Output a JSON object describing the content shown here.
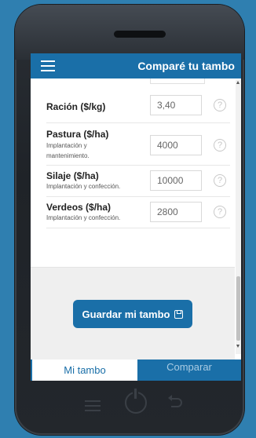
{
  "app": {
    "title": "Comparé tu tambo"
  },
  "form": {
    "rows": [
      {
        "label": "Ración ($/kg)",
        "sub": "",
        "value": "3,40"
      },
      {
        "label": "Pastura ($/ha)",
        "sub": "Implantación y mantenimiento.",
        "value": "4000"
      },
      {
        "label": "Silaje ($/ha)",
        "sub": "Implantación y confección.",
        "value": "10000"
      },
      {
        "label": "Verdeos ($/ha)",
        "sub": "Implantación y confección.",
        "value": "2800"
      }
    ],
    "help_glyph": "?"
  },
  "actions": {
    "save_label": "Guardar mi tambo"
  },
  "tabs": [
    {
      "label": "Mi tambo",
      "active": true
    },
    {
      "label": "Comparar",
      "active": false
    }
  ],
  "colors": {
    "brand": "#1a6fa8",
    "background": "#2f7fb0"
  }
}
